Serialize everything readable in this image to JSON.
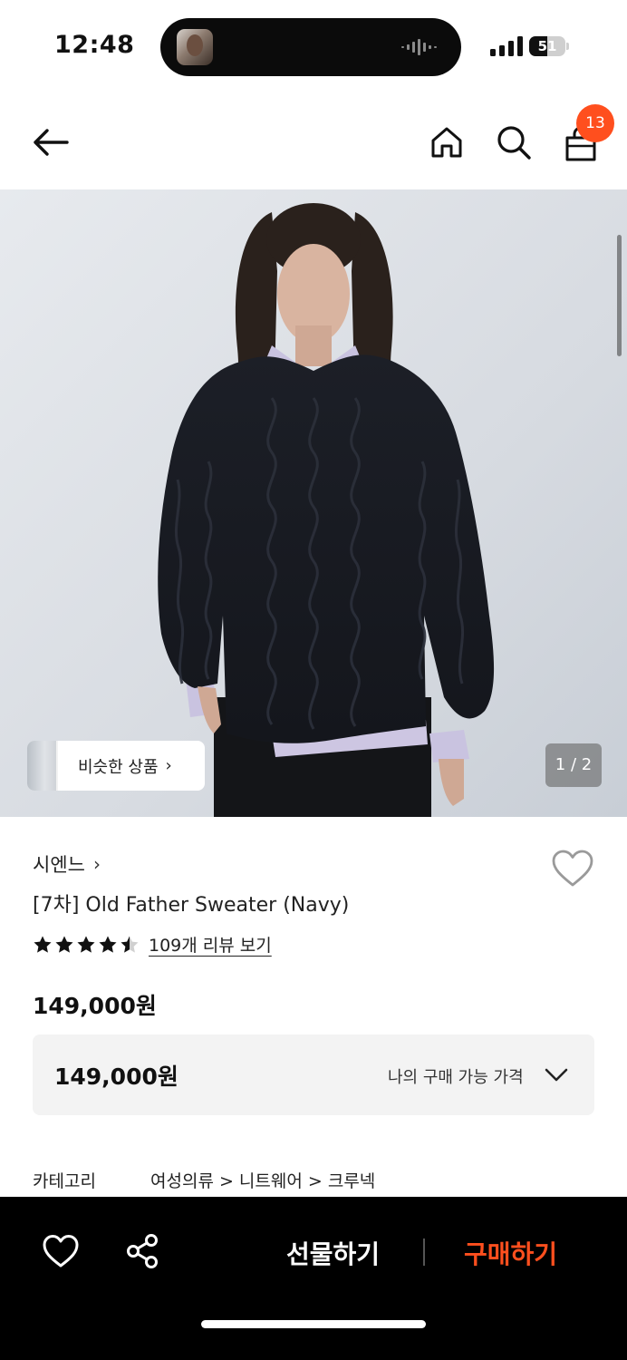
{
  "status_bar": {
    "time": "12:48",
    "battery_level": "51",
    "battery_fraction": 0.51,
    "signal_icon": "cellular-signal-icon",
    "island_icons": [
      "now-playing-avatar-icon",
      "audio-waveform-icon"
    ]
  },
  "nav": {
    "back_icon": "back-arrow-icon",
    "home_icon": "home-icon",
    "search_icon": "search-icon",
    "cart_icon": "shopping-bag-icon",
    "cart_count": "13",
    "badge_color": "#ff4f1e"
  },
  "hero": {
    "image_alt": "model wearing navy cable-knit sweater",
    "similar_label": "비슷한 상품",
    "similar_chevron": "›",
    "pager": "1 / 2"
  },
  "product": {
    "brand": "시엔느",
    "brand_chevron": "›",
    "name": "[7차] Old Father Sweater (Navy)",
    "rating": 4.5,
    "review_link": "109개 리뷰 보기",
    "price": "149,000원",
    "wish_icon": "heart-outline-icon"
  },
  "price_box": {
    "value": "149,000원",
    "label": "나의 구매 가능 가격",
    "chevron_icon": "chevron-down-icon"
  },
  "category": {
    "label": "카테고리",
    "path": "여성의류 > 니트웨어 > 크루넥"
  },
  "bottom_bar": {
    "heart_icon": "heart-outline-icon",
    "share_icon": "share-icon",
    "gift_label": "선물하기",
    "buy_label": "구매하기",
    "buy_color": "#ff4f1e"
  }
}
